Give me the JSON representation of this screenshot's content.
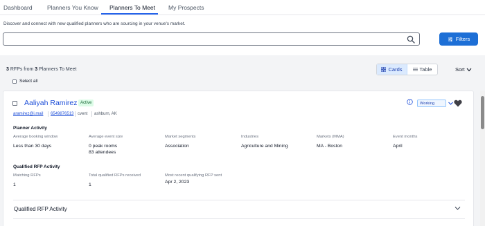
{
  "tabs": [
    {
      "label": "Dashboard"
    },
    {
      "label": "Planners You Know"
    },
    {
      "label": "Planners To Meet"
    },
    {
      "label": "My Prospects"
    }
  ],
  "subtitle": "Discover and connect with new qualified planners who are sourcing in your venue's market.",
  "search": {
    "value": "",
    "placeholder": ""
  },
  "filters_label": "Filters",
  "results": {
    "rfp_count": "3",
    "rfps_from": "RFPs from",
    "planner_count": "3",
    "planners_label": "Planners To Meet"
  },
  "select_all_label": "Select all",
  "view_toggle": {
    "cards_label": "Cards",
    "table_label": "Table"
  },
  "sort_label": "Sort",
  "card": {
    "name": "Aaliyah Ramirez",
    "status": "Active",
    "email": "aramirez@i.mail",
    "phone": "6549876513",
    "company": "cvent",
    "location": "ashburn, AK",
    "stage": "Working",
    "planner_activity": {
      "title": "Planner Activity",
      "fields": [
        {
          "label": "Average booking window",
          "value": "Less than 30 days",
          "value2": ""
        },
        {
          "label": "Average event size",
          "value": "0 peak rooms",
          "value2": "83 attendees"
        },
        {
          "label": "Market segments",
          "value": "Association",
          "value2": ""
        },
        {
          "label": "Industries",
          "value": "Agriculture and Mining",
          "value2": ""
        },
        {
          "label": "Markets (MMA)",
          "value": "MA - Boston",
          "value2": ""
        },
        {
          "label": "Event months",
          "value": "April",
          "value2": ""
        }
      ]
    },
    "qualified_activity": {
      "title": "Qualified RFP Activity",
      "fields": [
        {
          "label": "Matching RFPs",
          "value": "1"
        },
        {
          "label": "Total qualified RFPs received",
          "value": "1"
        },
        {
          "label": "Most recent qualifying RFP sent",
          "value": "Apr 2, 2023"
        }
      ]
    },
    "accordion_label": "Qualified RFP Activity"
  },
  "colors": {
    "accent": "#1d6fd6",
    "link": "#1d4ed8",
    "active_badge_bg": "#dcfce7"
  }
}
